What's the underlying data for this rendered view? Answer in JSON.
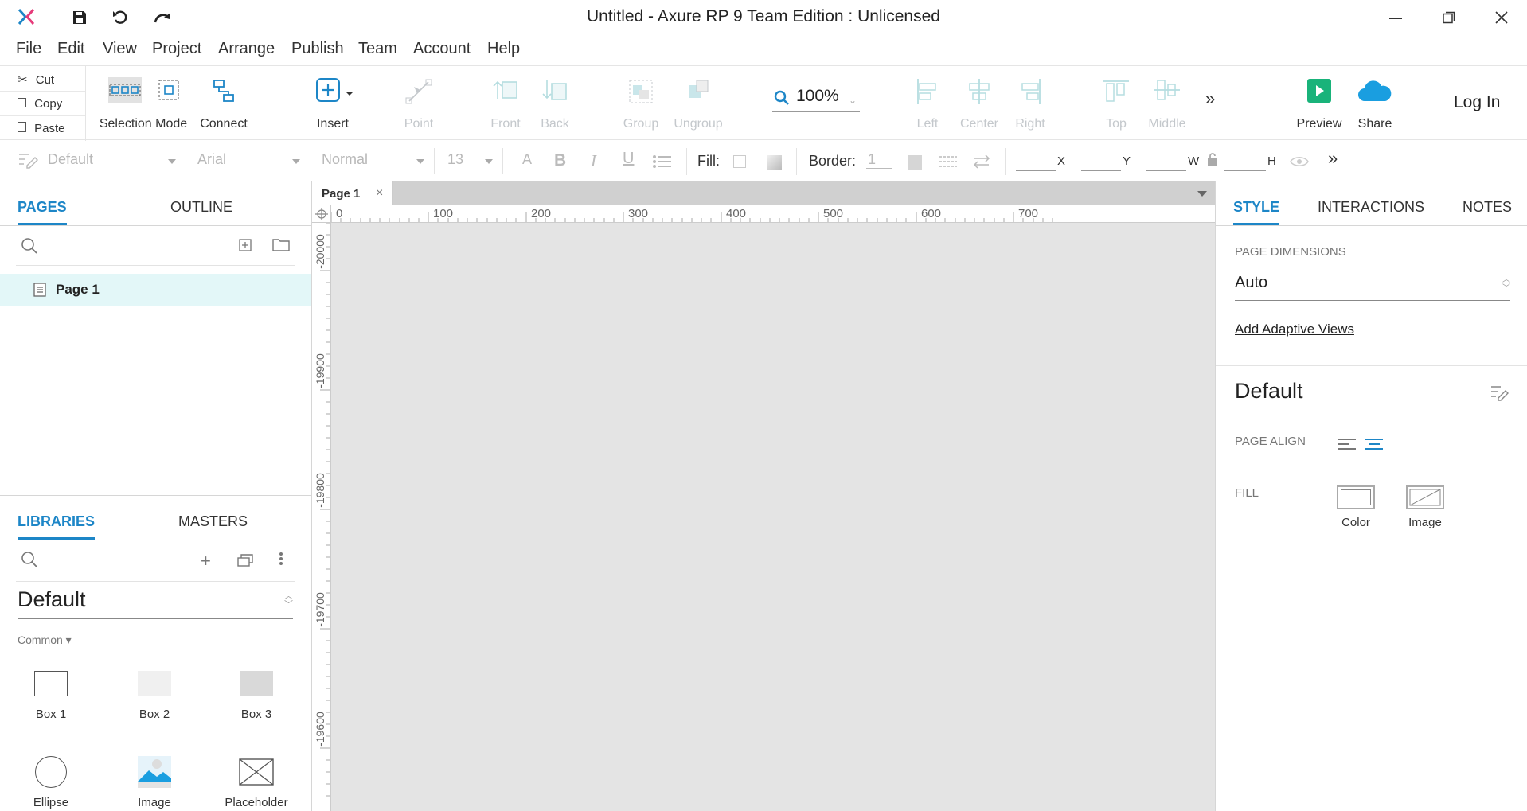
{
  "window": {
    "title": "Untitled - Axure RP 9 Team Edition : Unlicensed"
  },
  "menu": [
    "File",
    "Edit",
    "View",
    "Project",
    "Arrange",
    "Publish",
    "Team",
    "Account",
    "Help"
  ],
  "clipboard": {
    "cut": "Cut",
    "copy": "Copy",
    "paste": "Paste"
  },
  "toolbar": {
    "selection_mode": "Selection Mode",
    "connect": "Connect",
    "insert": "Insert",
    "point": "Point",
    "front": "Front",
    "back": "Back",
    "group": "Group",
    "ungroup": "Ungroup",
    "zoom": "100%",
    "left": "Left",
    "center": "Center",
    "right": "Right",
    "top": "Top",
    "middle": "Middle",
    "preview": "Preview",
    "share": "Share",
    "login": "Log In"
  },
  "format": {
    "style": "Default",
    "font": "Arial",
    "weight": "Normal",
    "size": "13",
    "fill_label": "Fill:",
    "border_label": "Border:",
    "border_value": "1",
    "x": "X",
    "y": "Y",
    "w": "W",
    "h": "H"
  },
  "left": {
    "tabs": {
      "pages": "PAGES",
      "outline": "OUTLINE"
    },
    "pages": [
      {
        "name": "Page 1"
      }
    ],
    "lib_tabs": {
      "libraries": "LIBRARIES",
      "masters": "MASTERS"
    },
    "library": "Default",
    "category": "Common ▾",
    "widgets": [
      "Box 1",
      "Box 2",
      "Box 3",
      "Ellipse",
      "Image",
      "Placeholder"
    ]
  },
  "canvas": {
    "tab": "Page 1",
    "hruler": [
      "0",
      "100",
      "200",
      "300",
      "400",
      "500",
      "600",
      "700"
    ],
    "vruler": [
      "-20000",
      "-19900",
      "-19800",
      "-19700",
      "-19600"
    ]
  },
  "right": {
    "tabs": {
      "style": "STYLE",
      "interactions": "INTERACTIONS",
      "notes": "NOTES"
    },
    "page_dimensions_label": "PAGE DIMENSIONS",
    "page_dimensions_value": "Auto",
    "adaptive_link": "Add Adaptive Views",
    "style_name": "Default",
    "page_align_label": "PAGE ALIGN",
    "fill_label": "FILL",
    "fill_color": "Color",
    "fill_image": "Image"
  },
  "colors": {
    "accent": "#1d86c7",
    "preview_green": "#19b37a",
    "share_blue": "#1a9ee0"
  }
}
